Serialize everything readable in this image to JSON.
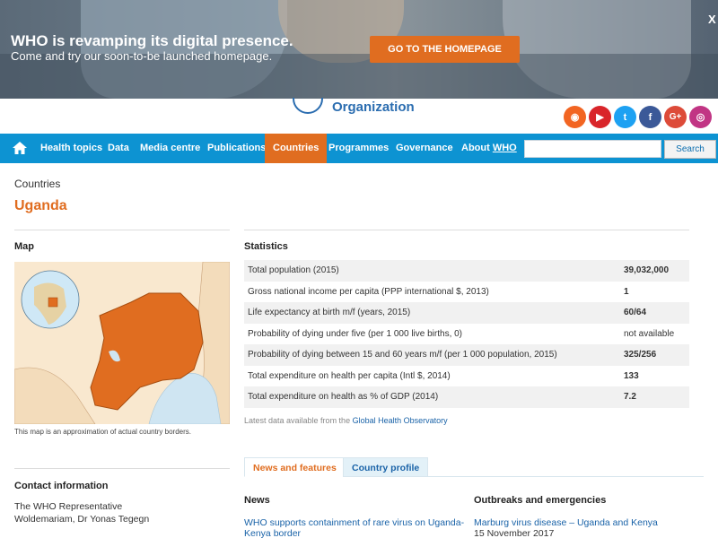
{
  "banner": {
    "title": "WHO is revamping its digital presence.",
    "subtitle": "Come and try our soon-to-be launched homepage.",
    "button_label": "GO TO THE HOMEPAGE",
    "close_label": "X"
  },
  "header": {
    "logo_text": "Organization",
    "social": [
      {
        "icon": "rss-icon",
        "glyph": "◉",
        "color": "#f26522"
      },
      {
        "icon": "youtube-icon",
        "glyph": "▶",
        "color": "#d9252a"
      },
      {
        "icon": "twitter-icon",
        "glyph": "t",
        "color": "#1da1f2"
      },
      {
        "icon": "facebook-icon",
        "glyph": "f",
        "color": "#3b5998"
      },
      {
        "icon": "googleplus-icon",
        "glyph": "G+",
        "color": "#dd4b39"
      },
      {
        "icon": "instagram-icon",
        "glyph": "◎",
        "color": "#c13584"
      }
    ]
  },
  "nav": {
    "items": [
      "Health topics",
      "Data",
      "Media centre",
      "Publications",
      "Countries",
      "Programmes",
      "Governance"
    ],
    "about_prefix": "About ",
    "about_u": "WHO",
    "active": "Countries",
    "search_placeholder": "",
    "search_button": "Search"
  },
  "page": {
    "breadcrumb": "Countries",
    "title": "Uganda"
  },
  "map": {
    "heading": "Map",
    "caption": "This map is an approximation of actual country borders."
  },
  "stats": {
    "heading": "Statistics",
    "rows": [
      {
        "label": "Total population (2015)",
        "value": "39,032,000"
      },
      {
        "label": "Gross national income per capita (PPP international $, 2013)",
        "value": "1"
      },
      {
        "label": "Life expectancy at birth m/f (years, 2015)",
        "value": "60/64"
      },
      {
        "label": "Probability of dying under five (per 1 000 live births, 0)",
        "value": "not available"
      },
      {
        "label": "Probability of dying between 15 and 60 years m/f (per 1 000 population, 2015)",
        "value": "325/256"
      },
      {
        "label": "Total expenditure on health per capita (Intl $, 2014)",
        "value": "133"
      },
      {
        "label": "Total expenditure on health as % of GDP (2014)",
        "value": "7.2"
      }
    ],
    "note_prefix": "Latest data available from the ",
    "note_link": "Global Health Observatory"
  },
  "tabs": [
    "News and features",
    "Country profile"
  ],
  "contact": {
    "heading": "Contact information",
    "line1": "The WHO Representative",
    "line2": "Woldemariam, Dr Yonas Tegegn"
  },
  "news": {
    "heading": "News",
    "item_line1": "WHO supports containment of rare virus on Uganda-",
    "item_line2": "Kenya border"
  },
  "outbreaks": {
    "heading": "Outbreaks and emergencies",
    "item": "Marburg virus disease – Uganda and Kenya",
    "date": "15 November 2017"
  },
  "colors": {
    "accent": "#e06d20",
    "nav_blue": "#0d93d2",
    "link": "#1a63a8"
  }
}
